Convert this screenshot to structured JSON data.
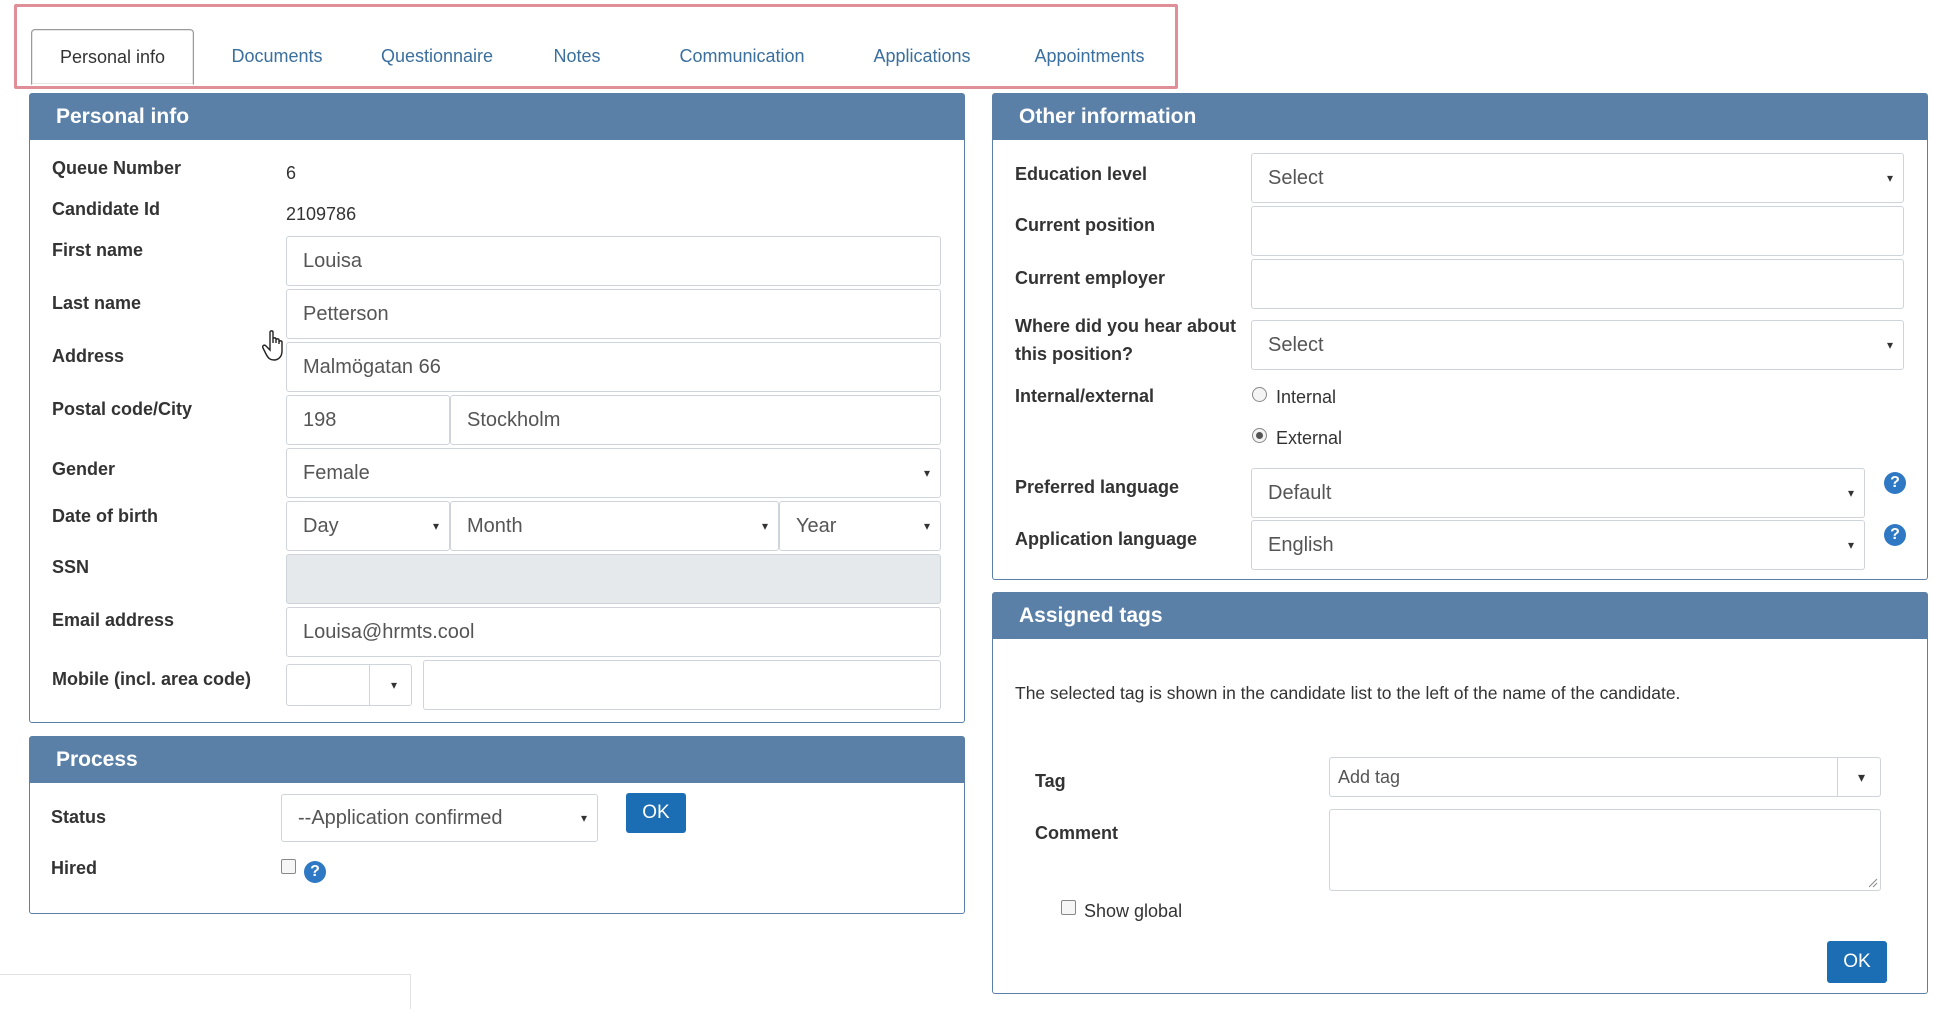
{
  "tabs": [
    {
      "label": "Personal info",
      "active": true
    },
    {
      "label": "Documents"
    },
    {
      "label": "Questionnaire"
    },
    {
      "label": "Notes"
    },
    {
      "label": "Communication"
    },
    {
      "label": "Applications"
    },
    {
      "label": "Appointments"
    }
  ],
  "personal": {
    "title": "Personal info",
    "queue_label": "Queue Number",
    "queue_value": "6",
    "candidate_label": "Candidate Id",
    "candidate_value": "2109786",
    "first_label": "First name",
    "first_value": "Louisa",
    "last_label": "Last name",
    "last_value": "Petterson",
    "address_label": "Address",
    "address_value": "Malmögatan 66",
    "postal_label": "Postal code/City",
    "postal_value": "198",
    "city_value": "Stockholm",
    "gender_label": "Gender",
    "gender_value": "Female",
    "dob_label": "Date of birth",
    "dob_day": "Day",
    "dob_month": "Month",
    "dob_year": "Year",
    "ssn_label": "SSN",
    "email_label": "Email address",
    "email_value": "Louisa@hrmts.cool",
    "mobile_label": "Mobile (incl. area code)"
  },
  "process": {
    "title": "Process",
    "status_label": "Status",
    "status_value": "--Application confirmed",
    "ok_label": "OK",
    "hired_label": "Hired"
  },
  "other": {
    "title": "Other information",
    "education_label": "Education level",
    "education_value": "Select",
    "position_label": "Current position",
    "employer_label": "Current employer",
    "hear_label_1": "Where did you hear about",
    "hear_label_2": "this position?",
    "hear_value": "Select",
    "intext_label": "Internal/external",
    "internal_label": "Internal",
    "external_label": "External",
    "pref_lang_label": "Preferred language",
    "pref_lang_value": "Default",
    "app_lang_label": "Application language",
    "app_lang_value": "English"
  },
  "tags": {
    "title": "Assigned tags",
    "description": "The selected tag is shown in the candidate list to the left of the name of the candidate.",
    "tag_label": "Tag",
    "tag_value": "Add tag",
    "comment_label": "Comment",
    "show_global_label": "Show global",
    "ok_label": "OK"
  },
  "icons": {
    "caret": "▾",
    "help": "?"
  },
  "colors": {
    "header_bg": "#5b80a8",
    "link": "#3a6f9e",
    "button": "#1c6eb4",
    "tab_highlight_border": "#e08e98"
  }
}
